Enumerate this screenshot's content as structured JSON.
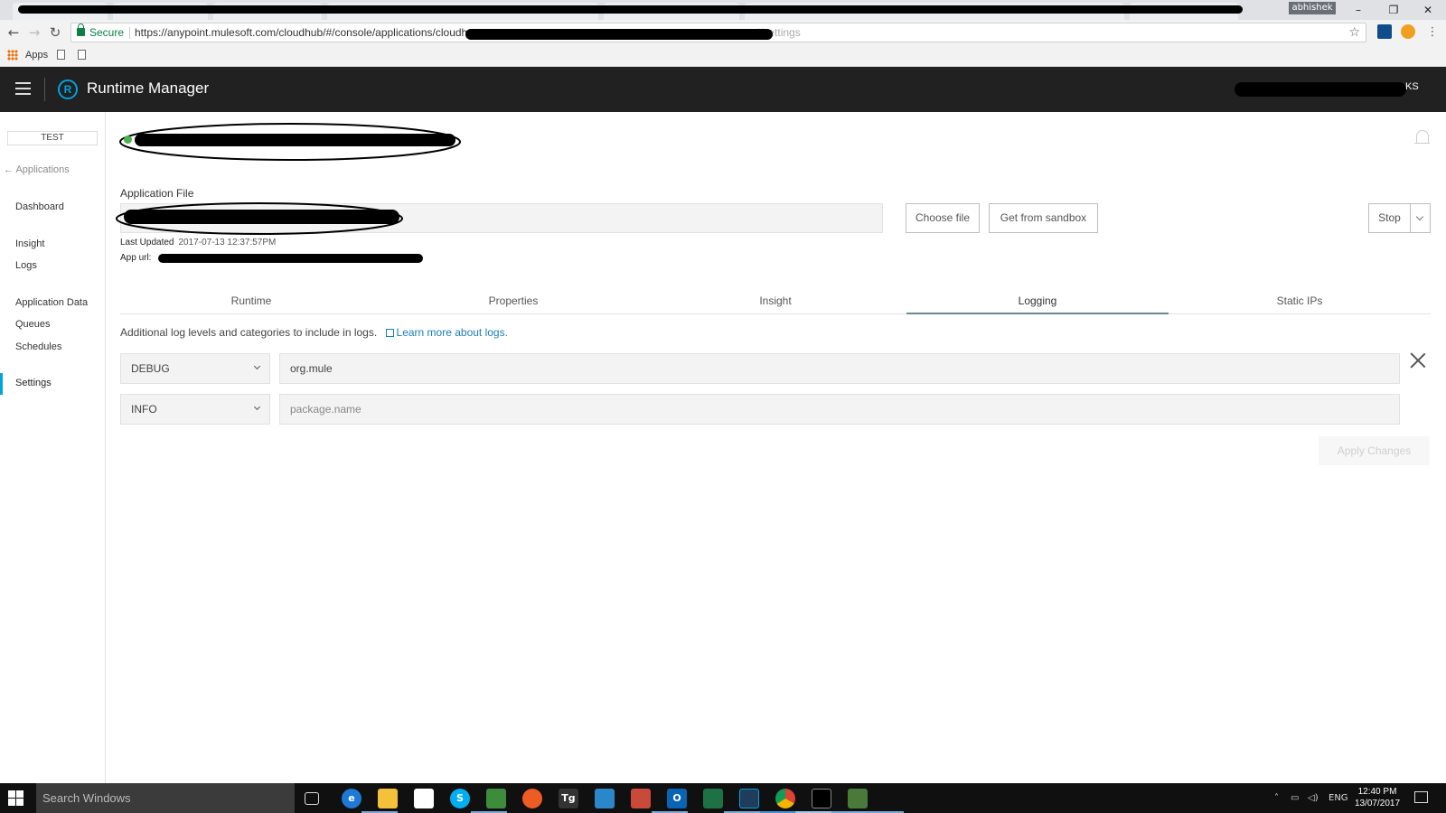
{
  "browser": {
    "profile_name": "abhishek",
    "secure_label": "Secure",
    "url": "https://anypoint.mulesoft.com/cloudhub/#/console/applications/cloudh",
    "url_tail": "ged/settings",
    "window_controls": [
      "–",
      "❐",
      "✕"
    ],
    "bookmarks": {
      "apps_label": "Apps"
    }
  },
  "header": {
    "title": "Runtime Manager",
    "logo_letter": "R",
    "user_initials": "KS"
  },
  "sidebar": {
    "environment": "TEST",
    "back_label": "Applications",
    "items": [
      {
        "label": "Dashboard"
      },
      {
        "label": "Insight"
      },
      {
        "label": "Logs"
      },
      {
        "label": "Application Data"
      },
      {
        "label": "Queues"
      },
      {
        "label": "Schedules"
      },
      {
        "label": "Settings",
        "active": true
      }
    ]
  },
  "main": {
    "application_file_label": "Application File",
    "choose_file_label": "Choose file",
    "get_from_sandbox_label": "Get from sandbox",
    "stop_label": "Stop",
    "last_updated_label": "Last Updated",
    "last_updated_value": "2017-07-13 12:37:57PM",
    "app_url_label": "App url:",
    "tabs": [
      {
        "label": "Runtime"
      },
      {
        "label": "Properties"
      },
      {
        "label": "Insight"
      },
      {
        "label": "Logging",
        "active": true
      },
      {
        "label": "Static IPs"
      }
    ],
    "logging": {
      "intro": "Additional log levels and categories to include in logs.",
      "learn_more": "Learn more about logs.",
      "rows": [
        {
          "level": "DEBUG",
          "category": "org.mule",
          "placeholder": ""
        },
        {
          "level": "INFO",
          "category": "",
          "placeholder": "package.name"
        }
      ],
      "apply_label": "Apply Changes"
    }
  },
  "taskbar": {
    "search_placeholder": "Search Windows",
    "language": "ENG",
    "time": "12:40 PM",
    "date": "13/07/2017",
    "pinned_icons": [
      "task-view-icon",
      "edge-icon",
      "file-explorer-icon",
      "store-icon",
      "skype-icon",
      "media-player-icon",
      "postman-icon",
      "telegram-icon",
      "remote-desktop-icon",
      "snipping-tool-icon",
      "outlook-icon",
      "excel-icon",
      "anypoint-studio-icon",
      "chrome-icon",
      "terminal-icon",
      "tools-icon"
    ],
    "telegram_label": "Tg"
  },
  "colors": {
    "accent": "#00a2df",
    "header_bg": "#212121",
    "link": "#1a7fb5",
    "status_green": "#4caf50"
  }
}
